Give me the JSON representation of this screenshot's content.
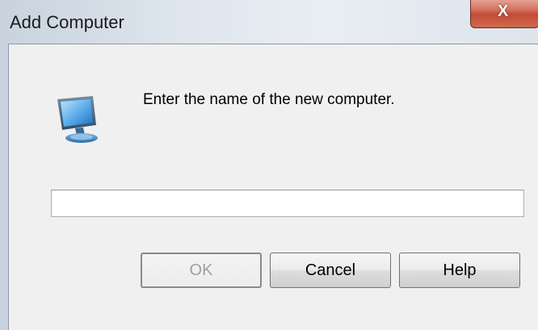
{
  "window": {
    "title": "Add Computer",
    "close_icon": "close-icon",
    "close_glyph": "X"
  },
  "dialog": {
    "icon": "computer-icon",
    "prompt": "Enter the name of the new computer.",
    "input_value": "",
    "input_placeholder": ""
  },
  "buttons": {
    "ok_label": "OK",
    "ok_enabled": false,
    "cancel_label": "Cancel",
    "help_label": "Help"
  },
  "colors": {
    "close_button": "#c44b38",
    "client_background": "#f0f0f0"
  }
}
